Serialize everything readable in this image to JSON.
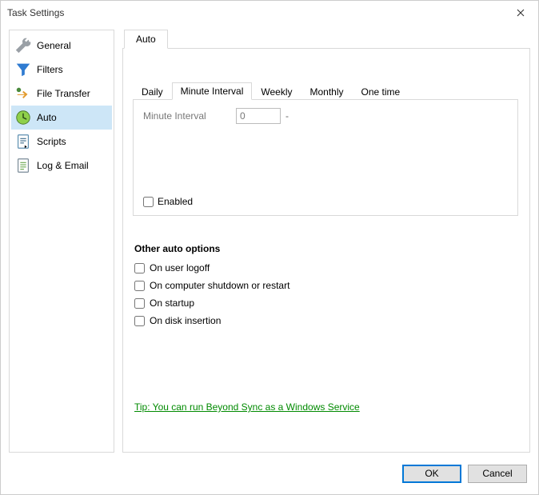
{
  "window": {
    "title": "Task Settings"
  },
  "nav": {
    "items": [
      {
        "label": "General"
      },
      {
        "label": "Filters"
      },
      {
        "label": "File Transfer"
      },
      {
        "label": "Auto"
      },
      {
        "label": "Scripts"
      },
      {
        "label": "Log & Email"
      }
    ],
    "selected_index": 3
  },
  "top_tab": {
    "label": "Auto"
  },
  "schedule_tabs": {
    "items": [
      {
        "label": "Daily"
      },
      {
        "label": "Minute Interval"
      },
      {
        "label": "Weekly"
      },
      {
        "label": "Monthly"
      },
      {
        "label": "One time"
      }
    ],
    "active_index": 1
  },
  "minute_interval": {
    "field_label": "Minute Interval",
    "value": "0",
    "suffix": "-"
  },
  "enabled": {
    "label": "Enabled",
    "checked": false
  },
  "other_options": {
    "title": "Other auto options",
    "items": [
      {
        "label": "On user logoff",
        "checked": false
      },
      {
        "label": "On computer shutdown or restart",
        "checked": false
      },
      {
        "label": "On startup",
        "checked": false
      },
      {
        "label": "On disk insertion",
        "checked": false
      }
    ]
  },
  "tip": {
    "text": "Tip: You can run Beyond Sync as a Windows Service"
  },
  "buttons": {
    "ok": "OK",
    "cancel": "Cancel"
  }
}
